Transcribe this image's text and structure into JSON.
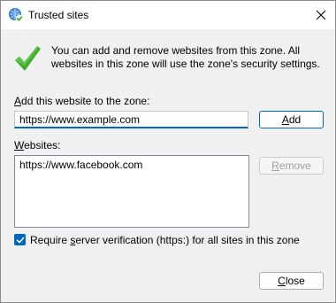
{
  "window": {
    "title": "Trusted sites",
    "close_icon": "close-icon",
    "app_icon": "globe-check-icon"
  },
  "info": {
    "icon": "green-checkmark-icon",
    "text": "You can add and remove websites from this zone. All websites in this zone will use the zone's security settings."
  },
  "add_section": {
    "label_prefix": "",
    "label_accel": "A",
    "label_rest": "dd this website to the zone:",
    "input_value": "https://www.example.com",
    "add_prefix": "",
    "add_accel": "A",
    "add_rest": "dd"
  },
  "websites_section": {
    "label_prefix": "",
    "label_accel": "W",
    "label_rest": "ebsites:",
    "items": [
      "https://www.facebook.com"
    ],
    "remove_prefix": "",
    "remove_accel": "R",
    "remove_rest": "emove"
  },
  "verification": {
    "checked": true,
    "label_prefix": "Require ",
    "label_accel": "s",
    "label_rest": "erver verification (https:) for all sites in this zone"
  },
  "footer": {
    "close_prefix": "",
    "close_accel": "C",
    "close_rest": "lose"
  },
  "colors": {
    "accent": "#0067c0",
    "check_green": "#3fae2a"
  }
}
